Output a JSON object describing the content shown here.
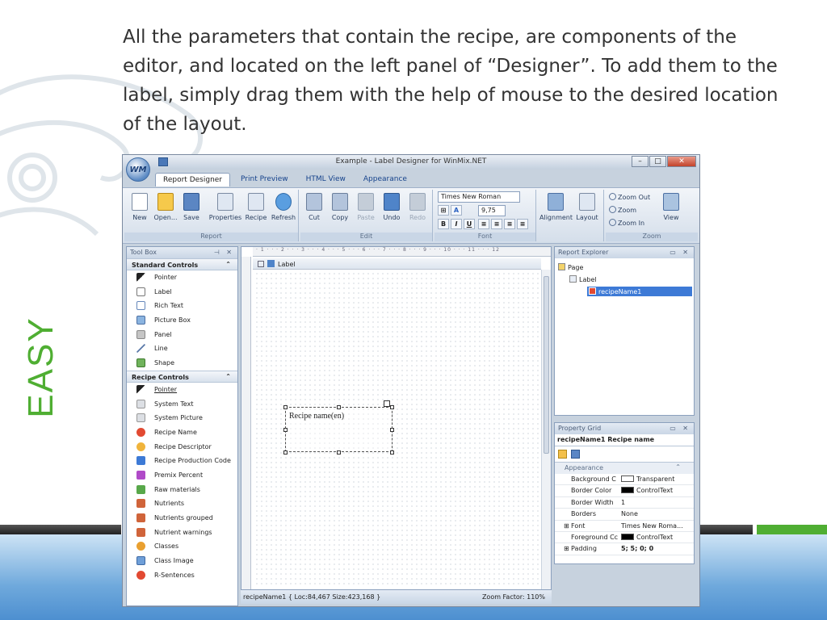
{
  "slide": {
    "intro_text": "All the parameters that contain the recipe, are components of the editor, and located on the left panel of “Designer”. To add them to the label, simply drag them with the help of mouse to the desired location of the layout.",
    "side_label": "EASY",
    "accent_green": "#4fae32"
  },
  "window": {
    "title": "Example - Label Designer for WinMix.NET",
    "orb_label": "WM",
    "minimize": "–",
    "maximize": "□",
    "close": "✕"
  },
  "tabs": [
    {
      "label": "Report Designer",
      "active": true
    },
    {
      "label": "Print Preview",
      "active": false
    },
    {
      "label": "HTML View",
      "active": false
    },
    {
      "label": "Appearance",
      "active": false
    }
  ],
  "ribbon": {
    "report": {
      "label": "Report",
      "new": "New",
      "open": "Open...",
      "save": "Save",
      "properties": "Properties",
      "recipe": "Recipe",
      "refresh": "Refresh"
    },
    "edit": {
      "label": "Edit",
      "cut": "Cut",
      "copy": "Copy",
      "paste": "Paste",
      "undo": "Undo",
      "redo": "Redo"
    },
    "font": {
      "label": "Font",
      "family": "Times New Roman",
      "size": "9,75",
      "bold": "B",
      "italic": "I",
      "underline": "U"
    },
    "alignment": "Alignment",
    "layout": "Layout",
    "zoom": {
      "label": "Zoom",
      "zoom_out": "Zoom Out",
      "zoom": "Zoom",
      "zoom_in": "Zoom In",
      "view": "View"
    }
  },
  "toolbox": {
    "title": "Tool Box",
    "standard": {
      "title": "Standard Controls",
      "items": [
        {
          "label": "Pointer",
          "icon": "pointer-icon"
        },
        {
          "label": "Label",
          "icon": "label-icon"
        },
        {
          "label": "Rich Text",
          "icon": "rich-text-icon"
        },
        {
          "label": "Picture Box",
          "icon": "picture-box-icon"
        },
        {
          "label": "Panel",
          "icon": "panel-icon"
        },
        {
          "label": "Line",
          "icon": "line-icon"
        },
        {
          "label": "Shape",
          "icon": "shape-icon"
        }
      ]
    },
    "recipe": {
      "title": "Recipe Controls",
      "items": [
        {
          "label": "Pointer",
          "icon": "pointer-icon"
        },
        {
          "label": "System Text",
          "icon": "system-text-icon"
        },
        {
          "label": "System Picture",
          "icon": "system-picture-icon"
        },
        {
          "label": "Recipe Name",
          "icon": "recipe-name-icon"
        },
        {
          "label": "Recipe Descriptor",
          "icon": "recipe-descriptor-icon"
        },
        {
          "label": "Recipe Production Code",
          "icon": "production-code-icon"
        },
        {
          "label": "Premix Percent",
          "icon": "premix-percent-icon"
        },
        {
          "label": "Raw materials",
          "icon": "raw-materials-icon"
        },
        {
          "label": "Nutrients",
          "icon": "nutrients-icon"
        },
        {
          "label": "Nutrients grouped",
          "icon": "nutrients-grouped-icon"
        },
        {
          "label": "Nutrient warnings",
          "icon": "nutrient-warnings-icon"
        },
        {
          "label": "Classes",
          "icon": "classes-icon"
        },
        {
          "label": "Class Image",
          "icon": "class-image-icon"
        },
        {
          "label": "R-Sentences",
          "icon": "r-sentences-icon"
        }
      ]
    }
  },
  "designer": {
    "ruler": "· 1 · · · 2 · · · 3 · · · 4 · · · 5 · · · 6 · · · 7 · · · 8 · · · 9 · · · 10 · · · 11 · · · 12",
    "band": "Label",
    "element_text": "Recipe name(en)",
    "status": "recipeName1 { Loc:84,467 Size:423,168 }",
    "zoom_factor": "Zoom Factor: 110%"
  },
  "explorer": {
    "title": "Report Explorer",
    "page": "Page",
    "label": "Label",
    "item": "recipeName1"
  },
  "property_grid": {
    "title": "Property Grid",
    "selected": "recipeName1   Recipe name",
    "category": "Appearance",
    "rows": [
      {
        "key": "Background C",
        "value": "Transparent",
        "swatch": "#ffffff"
      },
      {
        "key": "Border Color",
        "value": "ControlText",
        "swatch": "#000000"
      },
      {
        "key": "Border Width",
        "value": "1"
      },
      {
        "key": "Borders",
        "value": "None"
      },
      {
        "key": "Font",
        "value": "Times New Roma..."
      },
      {
        "key": "Foreground Cc",
        "value": "ControlText",
        "swatch": "#000000"
      },
      {
        "key": "Padding",
        "value": "5; 5; 0; 0"
      }
    ]
  }
}
